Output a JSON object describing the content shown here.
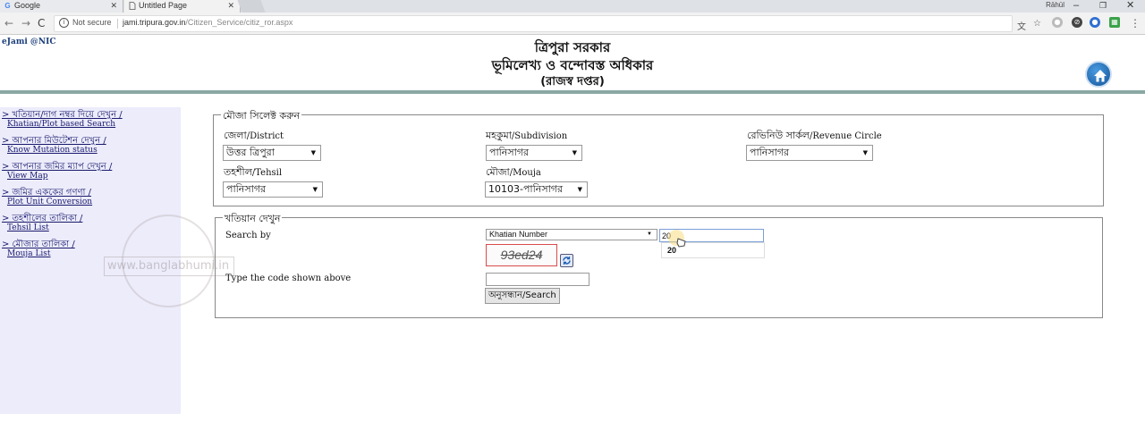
{
  "browser": {
    "tabs": [
      {
        "label": "Google",
        "icon": "G",
        "active": false
      },
      {
        "label": "Untitled Page",
        "icon": "page",
        "active": true
      }
    ],
    "user_name": "Rāhūl",
    "window_controls": {
      "minimize": "–",
      "restore": "❐",
      "close": "✕"
    },
    "address": {
      "security_label": "Not secure",
      "host": "jami.tripura.gov.in",
      "path": "/Citizen_Service/citiz_ror.aspx"
    }
  },
  "header": {
    "brand": "eJami @NIC",
    "title_line1": "ত্রিপুরা সরকার",
    "title_line2": "ভূমিলেখ্য ও বন্দোবস্ত অধিকার",
    "title_line3": "(রাজস্ব দপ্তর)"
  },
  "sidebar": {
    "items": [
      {
        "bn": "> খতিয়ান/দাগ নম্বর দিয়ে দেখুন /",
        "en": "Khatian/Plot based Search"
      },
      {
        "bn": "> আপনার মিউটেশন দেখুন /",
        "en": "Know Mutation status"
      },
      {
        "bn": "> আপনার জমির ম্যাপ দেখুন /",
        "en": "View Map"
      },
      {
        "bn": "> জমির এককের গণণা /",
        "en": "Plot Unit Conversion"
      },
      {
        "bn": "> তহশীলের তালিকা /",
        "en": "Tehsil List"
      },
      {
        "bn": "> মৌজার তালিকা /",
        "en": "Mouja List"
      }
    ],
    "watermark": "www.banglabhumi.in"
  },
  "mouja_section": {
    "legend": "মৌজা সিলেক্ট করুন",
    "district": {
      "label_bn": "জেলা",
      "label_en": "/District",
      "value": "উত্তর ত্রিপুরা"
    },
    "subdivision": {
      "label_bn": "মহকুমা",
      "label_en": "/Subdivision",
      "value": "পানিসাগর"
    },
    "revenue_circle": {
      "label_bn": "রেভিনিউ সার্কল",
      "label_en": "/Revenue Circle",
      "value": "পানিসাগর"
    },
    "tehsil": {
      "label_bn": "তহশীল",
      "label_en": "/Tehsil",
      "value": "পানিসাগর"
    },
    "mouja": {
      "label_bn": "মৌজা",
      "label_en": "/Mouja",
      "value": "10103-পানিসাগর"
    }
  },
  "khatian_section": {
    "legend": "খতিয়ান দেখুন",
    "search_by_label": "Search by",
    "search_by_value": "Khatian Number",
    "search_input_value": "20",
    "suggestion": "20",
    "captcha_text": "93ed24",
    "code_label": "Type the code shown above",
    "code_input_value": "",
    "search_button": "অনুসন্ধান/Search"
  }
}
